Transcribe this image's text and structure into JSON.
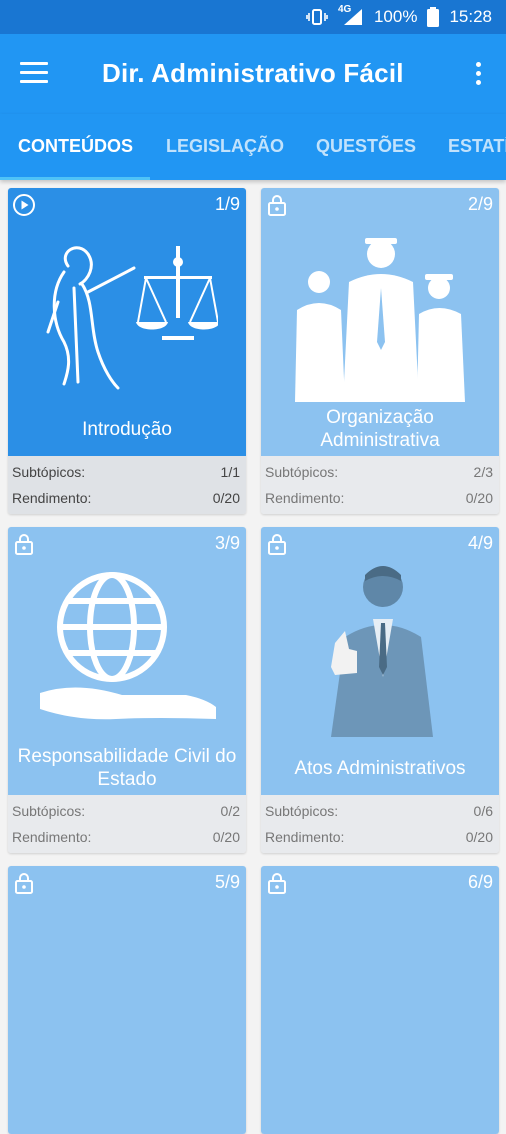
{
  "status": {
    "network": "4G",
    "battery": "100%",
    "time": "15:28"
  },
  "appbar": {
    "title": "Dir. Administrativo Fácil"
  },
  "tabs": [
    "CONTEÚDOS",
    "LEGISLAÇÃO",
    "QUESTÕES",
    "ESTATÍSTICAS"
  ],
  "labels": {
    "subtopics": "Subtópicos:",
    "yield": "Rendimento:"
  },
  "cards": [
    {
      "name": "Introdução",
      "index": "1/9",
      "subtopics": "1/1",
      "yield": "0/20",
      "locked": false
    },
    {
      "name": "Organização Administrativa",
      "index": "2/9",
      "subtopics": "2/3",
      "yield": "0/20",
      "locked": true
    },
    {
      "name": "Responsabilidade Civil do Estado",
      "index": "3/9",
      "subtopics": "0/2",
      "yield": "0/20",
      "locked": true
    },
    {
      "name": "Atos Administrativos",
      "index": "4/9",
      "subtopics": "0/6",
      "yield": "0/20",
      "locked": true
    },
    {
      "name": "",
      "index": "5/9",
      "locked": true
    },
    {
      "name": "",
      "index": "6/9",
      "locked": true
    }
  ],
  "colors": {
    "status": "#1976d2",
    "primary": "#2196f3",
    "active_card": "#2b8fe6",
    "locked_card": "#8cc2f0",
    "indicator": "#4fc3f7"
  }
}
